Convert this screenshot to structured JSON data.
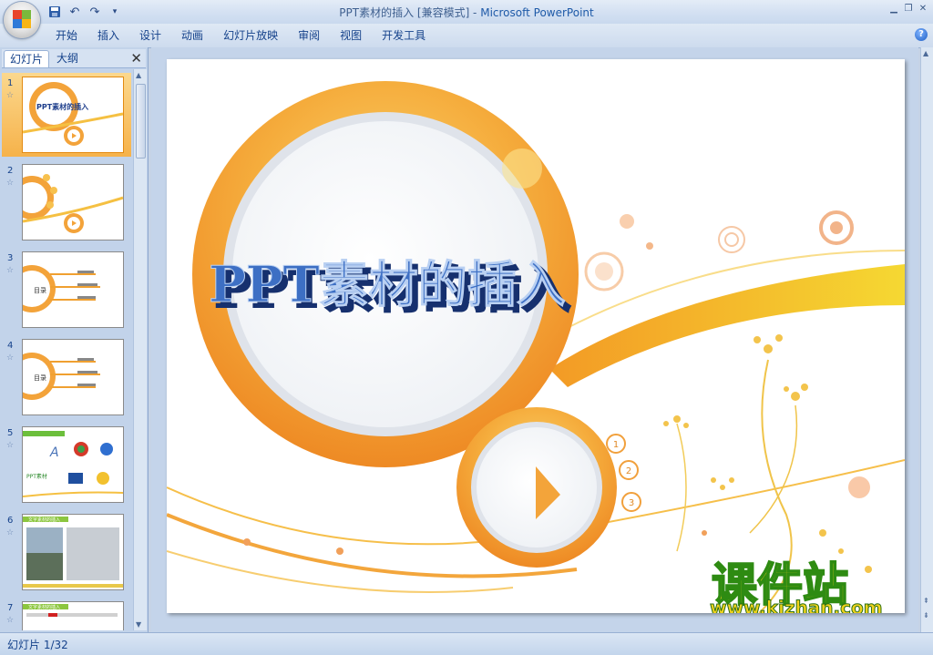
{
  "window": {
    "title_doc": "PPT素材的插入 [兼容模式] - ",
    "title_app": "Microsoft PowerPoint"
  },
  "qat": {
    "save_icon": "save-icon",
    "undo_icon": "undo-icon",
    "redo_icon": "redo-icon",
    "customize_icon": "customize-icon"
  },
  "ribbon": {
    "tabs": [
      "开始",
      "插入",
      "设计",
      "动画",
      "幻灯片放映",
      "审阅",
      "视图",
      "开发工具"
    ],
    "help": "?"
  },
  "panel": {
    "tab_slides": "幻灯片",
    "tab_outline": "大纲",
    "close": "✕",
    "thumbs": [
      {
        "num": "1",
        "title": "PPT素材的插入"
      },
      {
        "num": "2",
        "title": ""
      },
      {
        "num": "3",
        "title": "目录"
      },
      {
        "num": "4",
        "title": "目录"
      },
      {
        "num": "5",
        "title": "PPT素材"
      },
      {
        "num": "6",
        "title": "文字素材的插入"
      },
      {
        "num": "7",
        "title": "文字素材的插入"
      }
    ]
  },
  "slide": {
    "title": "PPT素材的插入",
    "menu_items": [
      "1",
      "2",
      "3"
    ]
  },
  "watermark": {
    "text": "课件站",
    "url": "www.kjzhan.com"
  },
  "status": {
    "slide_info": "幻灯片 1/32"
  },
  "colors": {
    "accent_orange": "#f29a2e",
    "accent_yellow": "#f7c94a",
    "ribbon_blue": "#15428b"
  }
}
